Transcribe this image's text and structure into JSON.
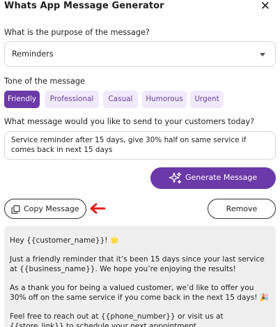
{
  "dialog": {
    "title": "Whats App Message Generator",
    "close_icon": "close-icon"
  },
  "purpose": {
    "label": "What is the purpose of the message?",
    "selected": "Reminders"
  },
  "tone": {
    "label": "Tone of the message",
    "options": [
      "Friendly",
      "Professional",
      "Casual",
      "Humorous",
      "Urgent"
    ],
    "selected": "Friendly"
  },
  "message_input": {
    "label": "What message would you like to send to your customers today?",
    "value": "Service reminder after 15 days, give 30% half on same service if comes back in next 15 days"
  },
  "generate_button": {
    "label": "Generate Message",
    "icon": "sparkles-icon"
  },
  "copy_button": {
    "label": "Copy Message",
    "icon": "copy-icon"
  },
  "remove_button": {
    "label": "Remove"
  },
  "annotations": {
    "arrow_color": "#e0201b"
  },
  "colors": {
    "accent": "#6b3aa8",
    "chip_bg": "#f1eafb",
    "output_bg": "#efefef"
  },
  "output": {
    "paragraphs": [
      "Hey {{customer_name}}! 🌟",
      "Just a friendly reminder that it’s been 15 days since your last service at {{business_name}}. We hope you’re enjoying the results!",
      "As a thank you for being a valued customer, we’d like to offer you 30% off on the same service if you come back in the next 15 days! 🎉",
      "Feel free to reach out at {{phone_number}} or visit us at {{store_link}} to schedule your next appointment."
    ]
  }
}
